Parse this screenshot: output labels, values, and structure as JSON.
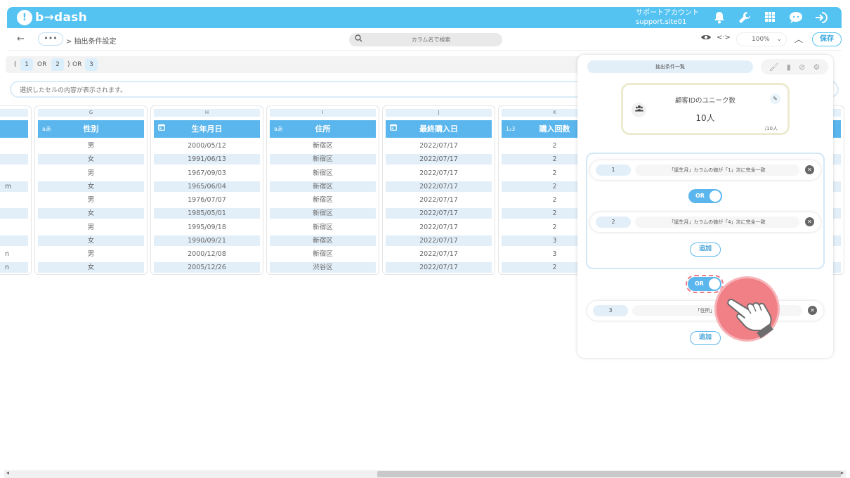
{
  "app": {
    "logo_badge": "!",
    "logo_text": "b→dash",
    "support_line1": "サポートアカウント",
    "support_line2": "support.site01",
    "header_icons": [
      "bell-icon",
      "wrench-icon",
      "grid-icon",
      "chat-icon",
      "logout-icon"
    ]
  },
  "toolbar": {
    "back": "←",
    "dots": "•••",
    "breadcrumb": "> 抽出条件設定",
    "search_placeholder": "カラム名で検索",
    "zoom": "100%",
    "save": "保存"
  },
  "condition_bar": {
    "open": "(",
    "c1": "1",
    "or1": "OR",
    "c2": "2",
    "close": ")",
    "or2": "OR",
    "c3": "3"
  },
  "info_placeholder": "選択したセルの内容が表示されます。",
  "table": {
    "partial_col": {
      "cells": [
        "",
        "",
        "",
        "m",
        "",
        "",
        "",
        "",
        "n",
        "n"
      ]
    },
    "columns": [
      {
        "letter": "G",
        "type_icon": "aあ",
        "header": "性別",
        "cells": [
          "男",
          "女",
          "男",
          "女",
          "男",
          "女",
          "男",
          "女",
          "男",
          "女"
        ]
      },
      {
        "letter": "H",
        "type_icon": "📅",
        "header": "生年月日",
        "cells": [
          "2000/05/12",
          "1991/06/13",
          "1967/09/03",
          "1965/06/04",
          "1976/07/07",
          "1985/05/01",
          "1995/09/18",
          "1990/09/21",
          "2000/12/08",
          "2005/12/26"
        ]
      },
      {
        "letter": "I",
        "type_icon": "aあ",
        "header": "住所",
        "cells": [
          "新宿区",
          "新宿区",
          "新宿区",
          "新宿区",
          "新宿区",
          "新宿区",
          "新宿区",
          "新宿区",
          "新宿区",
          "渋谷区"
        ]
      },
      {
        "letter": "J",
        "type_icon": "📅",
        "header": "最終購入日",
        "cells": [
          "2022/07/17",
          "2022/07/17",
          "2022/07/17",
          "2022/07/17",
          "2022/07/17",
          "2022/07/17",
          "2022/07/17",
          "2022/07/17",
          "2022/07/17",
          "2022/07/17"
        ]
      },
      {
        "letter": "K",
        "type_icon": "1₂3",
        "header": "購入回数",
        "cells": [
          "2",
          "2",
          "2",
          "2",
          "2",
          "2",
          "2",
          "3",
          "3",
          "2"
        ]
      }
    ]
  },
  "panel": {
    "title": "抽出条件一覧",
    "stat": {
      "label": "顧客IDのユニーク数",
      "value": "10人",
      "total": "/10人"
    },
    "conditions": [
      {
        "num": "1",
        "text": "「誕生月」カラムの値が「1」次に完全一致"
      },
      {
        "num": "2",
        "text": "「誕生月」カラムの値が「4」次に完全一致"
      },
      {
        "num": "3",
        "text": "「住所」カラムの値"
      }
    ],
    "toggle_inner": "OR",
    "toggle_outer": "OR",
    "add_inner": "追加",
    "add_outer": "追加"
  }
}
